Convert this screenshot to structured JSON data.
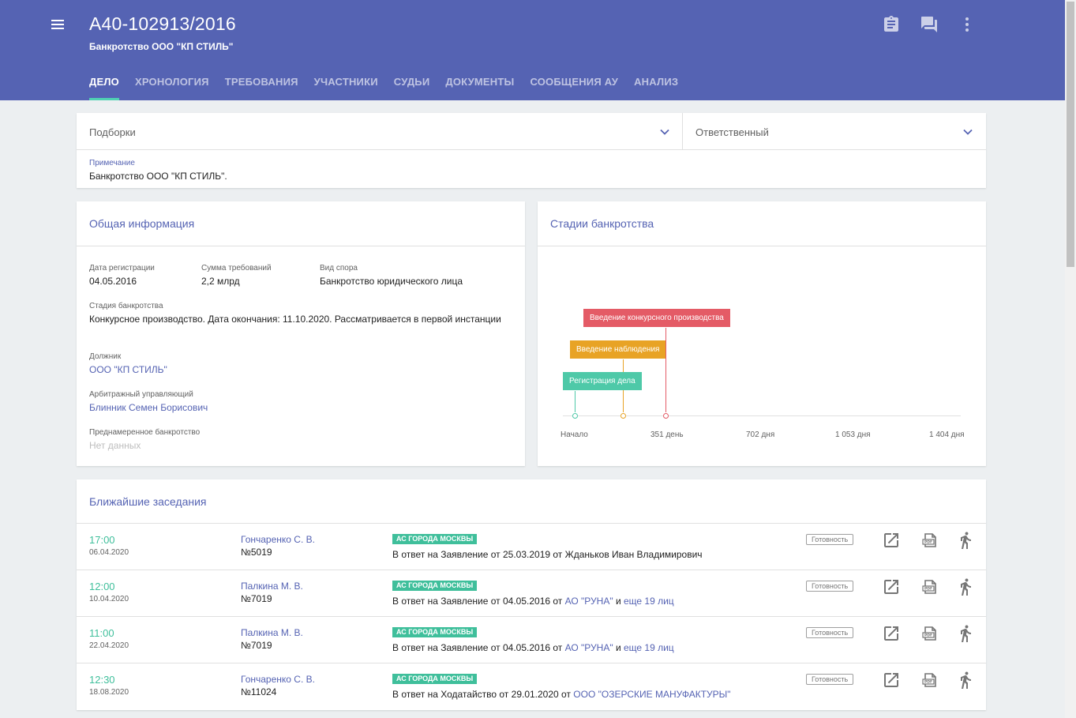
{
  "header": {
    "title": "А40-102913/2016",
    "subtitle": "Банкротство ООО \"КП СТИЛЬ\"",
    "tabs": [
      "ДЕЛО",
      "ХРОНОЛОГИЯ",
      "ТРЕБОВАНИЯ",
      "УЧАСТНИКИ",
      "СУДЬИ",
      "ДОКУМЕНТЫ",
      "СООБЩЕНИЯ АУ",
      "АНАЛИЗ"
    ],
    "active_tab": "ДЕЛО",
    "icons": [
      "menu-icon",
      "clipboard-icon",
      "chat-icon",
      "more-vert-icon"
    ],
    "color": "#5563b3"
  },
  "filters": {
    "collections_label": "Подборки",
    "responsible_label": "Ответственный",
    "note_label": "Примечание",
    "note_text": "Банкротство ООО \"КП СТИЛЬ\"."
  },
  "info": {
    "title": "Общая информация",
    "reg_date_label": "Дата регистрации",
    "reg_date": "04.05.2016",
    "claims_label": "Сумма требований",
    "claims": "2,2 млрд",
    "dispute_label": "Вид спора",
    "dispute": "Банкротство юридического лица",
    "stage_label": "Стадия банкротства",
    "stage": "Конкурсное производство. Дата окончания: 11.10.2020. Рассматривается в первой инстанции",
    "debtor_label": "Должник",
    "debtor": "ООО \"КП СТИЛЬ\"",
    "manager_label": "Арбитражный управляющий",
    "manager": "Блинник Семен Борисович",
    "deliberate_label": "Преднамеренное банкротство",
    "deliberate": "Нет данных"
  },
  "stages": {
    "title": "Стадии банкротства",
    "ticks": [
      "Начало",
      "351 день",
      "702 дня",
      "1 053 дня",
      "1 404 дня"
    ],
    "axis_max_days": 1404,
    "items": [
      {
        "label": "Регистрация дела",
        "day": 0,
        "color": "#4ec9a8"
      },
      {
        "label": "Введение наблюдения",
        "day": 175,
        "color": "#e8a325"
      },
      {
        "label": "Введение конкурсного производства",
        "day": 325,
        "color": "#e45b66"
      }
    ]
  },
  "hearings": {
    "title": "Ближайшие заседания",
    "ready_label": "Готовность",
    "row_icons": [
      "open-external-icon",
      "pdf-icon",
      "walking-person-icon"
    ],
    "rows": [
      {
        "time": "17:00",
        "date": "06.04.2020",
        "judge": "Гончаренко С. В.",
        "room": "№5019",
        "court": "АС ГОРОДА МОСКВЫ",
        "desc": "В ответ на Заявление от 25.03.2019 от Жданьков Иван Владимирович",
        "party": "",
        "more": "",
        "and": ""
      },
      {
        "time": "12:00",
        "date": "10.04.2020",
        "judge": "Палкина М. В.",
        "room": "№7019",
        "court": "АС ГОРОДА МОСКВЫ",
        "desc": "В ответ на Заявление от 04.05.2016 от",
        "party": "АО \"РУНА\"",
        "and": "и",
        "more": "еще 19 лиц"
      },
      {
        "time": "11:00",
        "date": "22.04.2020",
        "judge": "Палкина М. В.",
        "room": "№7019",
        "court": "АС ГОРОДА МОСКВЫ",
        "desc": "В ответ на Заявление от 04.05.2016 от",
        "party": "АО \"РУНА\"",
        "and": "и",
        "more": "еще 19 лиц"
      },
      {
        "time": "12:30",
        "date": "18.08.2020",
        "judge": "Гончаренко С. В.",
        "room": "№11024",
        "court": "АС ГОРОДА МОСКВЫ",
        "desc": "В ответ на Ходатайство от 29.01.2020 от",
        "party": "ООО \"ОЗЕРСКИЕ МАНУФАКТУРЫ\"",
        "and": "",
        "more": ""
      }
    ]
  }
}
